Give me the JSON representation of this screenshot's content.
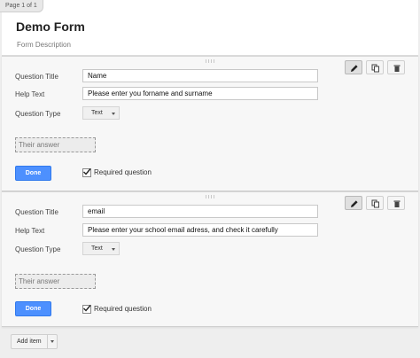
{
  "page_tab": "Page 1 of 1",
  "form": {
    "title": "Demo Form",
    "description": "Form Description"
  },
  "questions": [
    {
      "labels": {
        "title": "Question Title",
        "help": "Help Text",
        "type": "Question Type"
      },
      "title_value": "Name",
      "help_value": "Please enter you forname and surname",
      "type_value": "Text",
      "answer_placeholder": "Their answer",
      "done_label": "Done",
      "required_label": "Required question",
      "required_checked": true
    },
    {
      "labels": {
        "title": "Question Title",
        "help": "Help Text",
        "type": "Question Type"
      },
      "title_value": "email",
      "help_value": "Please enter your school email adress, and check it carefully",
      "type_value": "Text",
      "answer_placeholder": "Their answer",
      "done_label": "Done",
      "required_label": "Required question",
      "required_checked": true
    }
  ],
  "toolbar_icons": [
    "pencil-icon",
    "duplicate-icon",
    "trash-icon"
  ],
  "add_item": {
    "label": "Add item"
  },
  "colors": {
    "primary_button": "#4d90fe",
    "background": "#eeeeee",
    "card": "#f7f7f7"
  }
}
